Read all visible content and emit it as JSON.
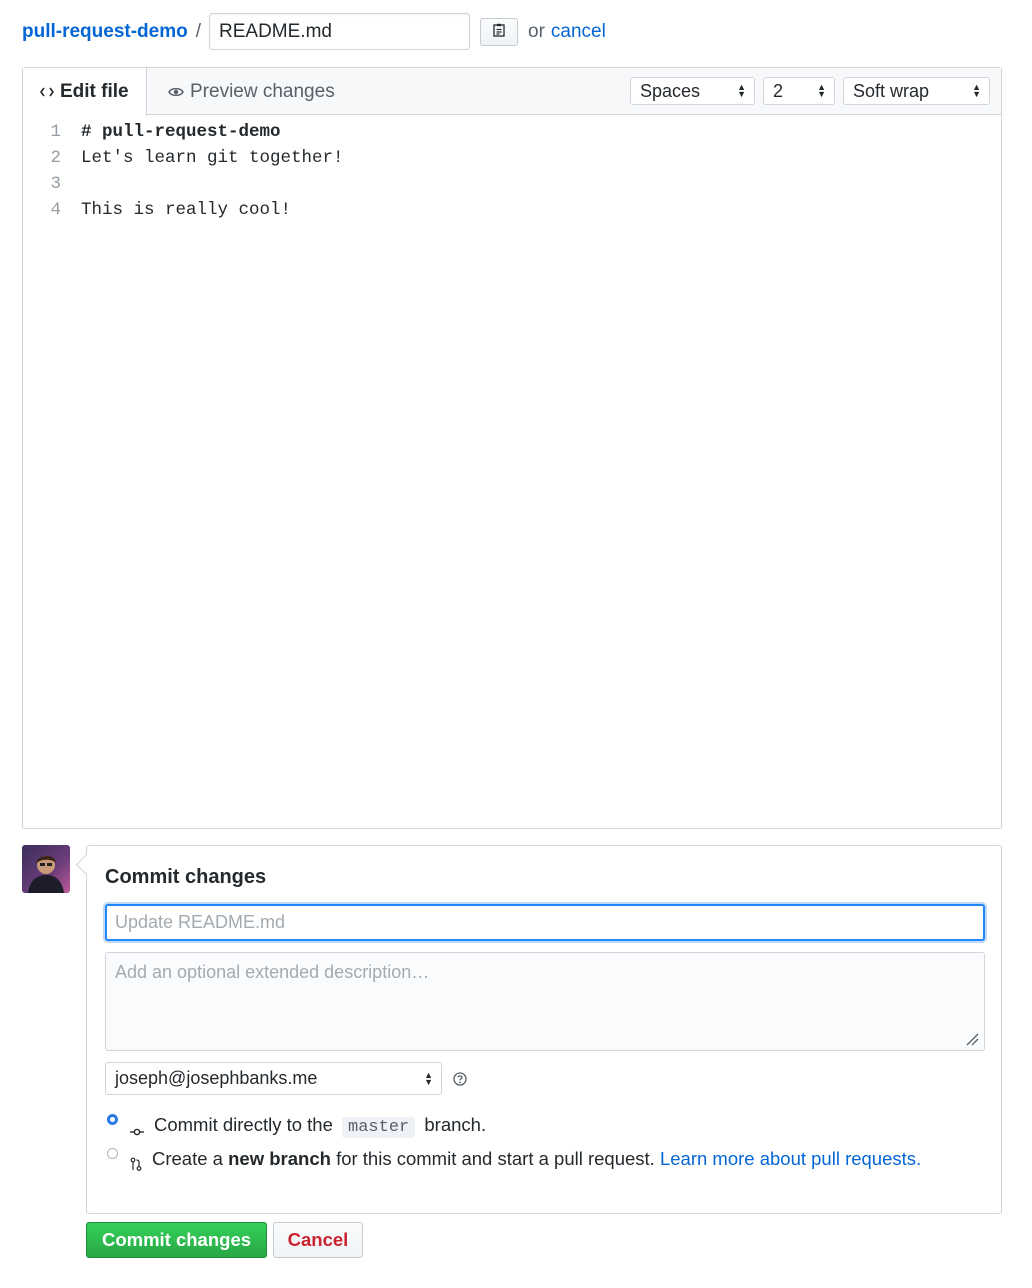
{
  "breadcrumb": {
    "repo_name": "pull-request-demo",
    "separator": "/",
    "filename_value": "README.md",
    "or_text": "or",
    "cancel_link": "cancel"
  },
  "editor": {
    "tabs": {
      "edit": "Edit file",
      "preview": "Preview changes"
    },
    "indent_mode": "Spaces",
    "indent_size": "2",
    "wrap_mode": "Soft wrap",
    "lines": [
      {
        "num": "1",
        "text": "# pull-request-demo"
      },
      {
        "num": "2",
        "text": "Let's learn git together!"
      },
      {
        "num": "3",
        "text": ""
      },
      {
        "num": "4",
        "text": "This is really cool!"
      }
    ]
  },
  "commit": {
    "title": "Commit changes",
    "summary_placeholder": "Update README.md",
    "description_placeholder": "Add an optional extended description…",
    "email": "joseph@josephbanks.me",
    "option_direct": {
      "prefix": "Commit directly to the",
      "branch": "master",
      "suffix": "branch."
    },
    "option_new_branch": {
      "prefix": "Create a",
      "bold": "new branch",
      "middle": "for this commit and start a pull request.",
      "link": "Learn more about pull requests."
    }
  },
  "buttons": {
    "commit": "Commit changes",
    "cancel": "Cancel"
  },
  "colors": {
    "link": "#0366d6",
    "commit_green": "#28a745",
    "cancel_red": "#cb2431",
    "focus_blue": "#2188ff"
  },
  "icons": [
    "clippy-icon",
    "code-icon",
    "eye-icon",
    "help-icon",
    "git-commit-icon",
    "git-pull-request-icon",
    "resize-grip-icon"
  ]
}
